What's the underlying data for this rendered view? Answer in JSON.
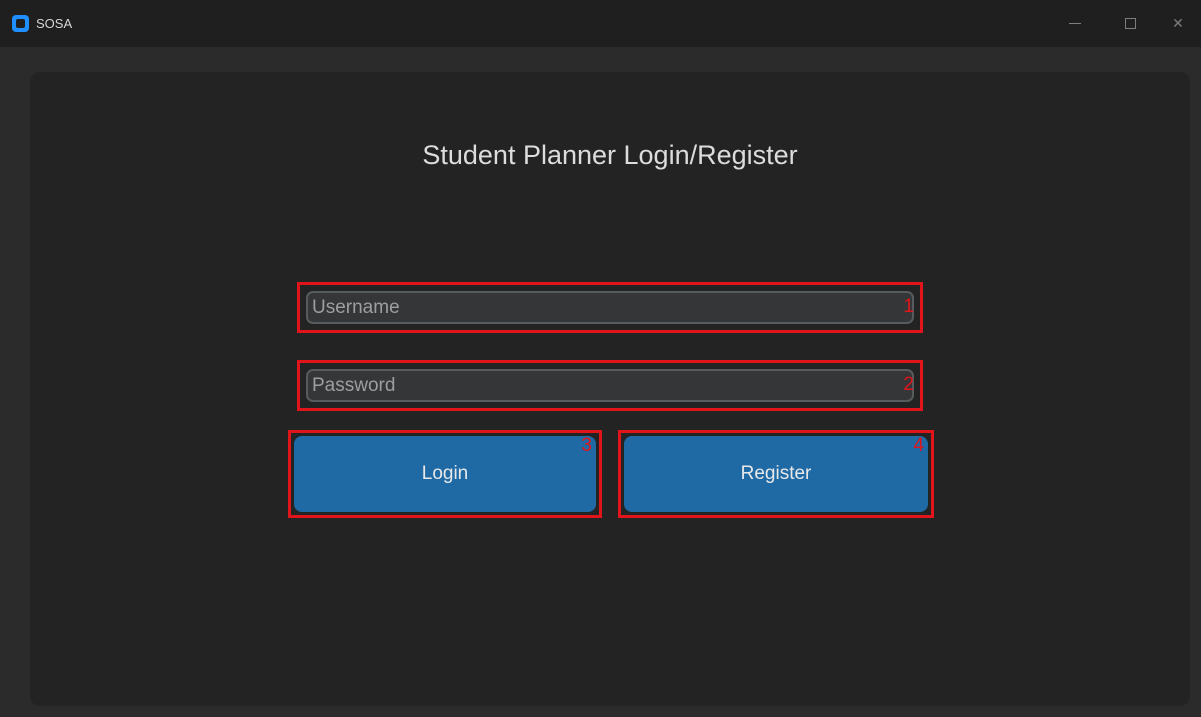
{
  "window": {
    "title": "SOSA",
    "icon": "app-icon",
    "controls": [
      "minimize-icon",
      "maximize-icon",
      "close-icon"
    ],
    "close_glyph": "✕"
  },
  "page": {
    "title": "Student Planner Login/Register"
  },
  "form": {
    "username": {
      "value": "",
      "placeholder": "Username",
      "marker": "1"
    },
    "password": {
      "value": "",
      "placeholder": "Password",
      "marker": "2"
    },
    "login": {
      "label": "Login",
      "marker": "3"
    },
    "register": {
      "label": "Register",
      "marker": "4"
    }
  },
  "colors": {
    "accent_button": "#1f6aa5",
    "annotation_red": "#e0151b",
    "background": "#232323"
  }
}
